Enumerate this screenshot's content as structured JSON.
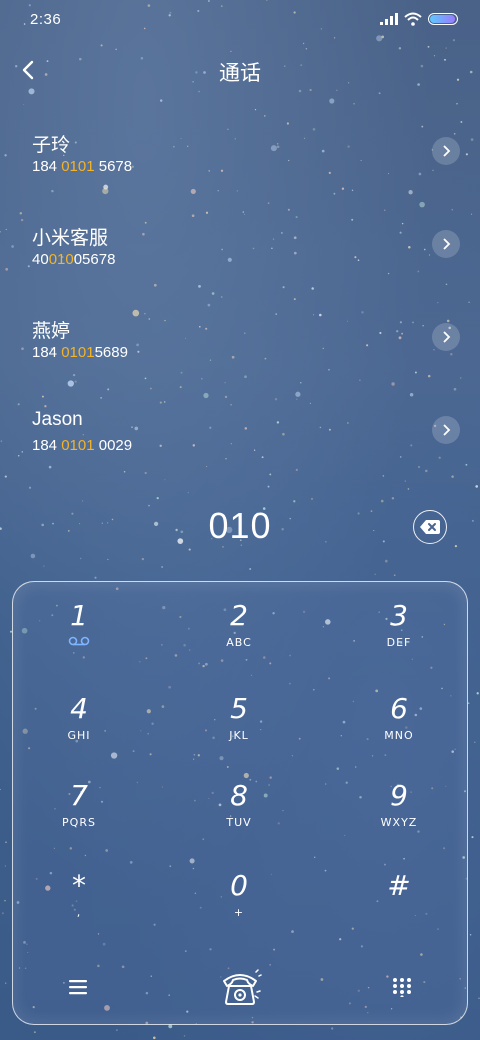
{
  "status_bar": {
    "time": "2:36",
    "icons": [
      "signal-icon",
      "wifi-icon",
      "battery-icon"
    ],
    "battery_level": 0.95
  },
  "header": {
    "back_icon": "back-arrow-icon",
    "title": "通话"
  },
  "contacts": [
    {
      "name": "子玲",
      "number_before": "184 ",
      "number_match": "0101",
      "number_after": " 5678"
    },
    {
      "name": "小米客服",
      "number_before": "40",
      "number_match": "010",
      "number_after": "05678"
    },
    {
      "name": "燕婷",
      "number_before": "184 ",
      "number_match": "0101",
      "number_after": "5689"
    },
    {
      "name": "Jason",
      "number_before": "184 ",
      "number_match": "0101",
      "number_after": " 0029"
    }
  ],
  "colors": {
    "match_highlight": "#f5b325",
    "voicemail_icon": "#7fb4ff",
    "text": "#ffffff"
  },
  "dial": {
    "typed_number": "010",
    "delete_icon": "backspace-icon"
  },
  "keypad": {
    "keys": [
      {
        "digit": "1",
        "letters": ""
      },
      {
        "digit": "2",
        "letters": "ABC"
      },
      {
        "digit": "3",
        "letters": "DEF"
      },
      {
        "digit": "4",
        "letters": "GHI"
      },
      {
        "digit": "5",
        "letters": "JKL"
      },
      {
        "digit": "6",
        "letters": "MNO"
      },
      {
        "digit": "7",
        "letters": "PQRS"
      },
      {
        "digit": "8",
        "letters": "TUV"
      },
      {
        "digit": "9",
        "letters": "WXYZ"
      },
      {
        "digit": "*",
        "letters": ","
      },
      {
        "digit": "0",
        "letters": "+"
      },
      {
        "digit": "#",
        "letters": ""
      }
    ],
    "key1_sub_icon": "voicemail-icon",
    "bottom_buttons": [
      "menu-icon",
      "phone-call-icon",
      "dialpad-grid-icon"
    ]
  }
}
